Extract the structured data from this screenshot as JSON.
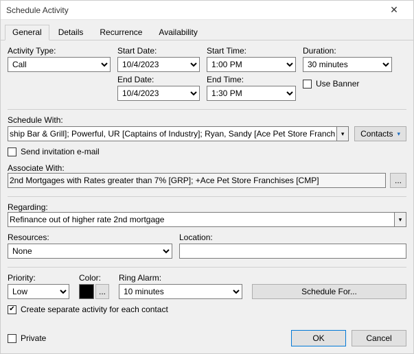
{
  "window": {
    "title": "Schedule Activity"
  },
  "tabs": {
    "general": "General",
    "details": "Details",
    "recurrence": "Recurrence",
    "availability": "Availability"
  },
  "labels": {
    "activity_type": "Activity Type:",
    "start_date": "Start Date:",
    "start_time": "Start Time:",
    "duration": "Duration:",
    "end_date": "End Date:",
    "end_time": "End Time:",
    "use_banner": "Use Banner",
    "schedule_with": "Schedule With:",
    "contacts_btn": "Contacts",
    "send_invite": "Send invitation e-mail",
    "associate_with": "Associate With:",
    "regarding": "Regarding:",
    "resources": "Resources:",
    "location": "Location:",
    "priority": "Priority:",
    "color": "Color:",
    "ring_alarm": "Ring Alarm:",
    "schedule_for": "Schedule For...",
    "create_separate": "Create separate activity for each contact",
    "private": "Private",
    "ok": "OK",
    "cancel": "Cancel",
    "ellipsis": "..."
  },
  "values": {
    "activity_type": "Call",
    "start_date": "10/4/2023",
    "end_date": "10/4/2023",
    "start_time": "1:00 PM",
    "end_time": "1:30 PM",
    "duration": "30 minutes",
    "schedule_with": "ship Bar & Grill]; Powerful, UR [Captains of Industry]; Ryan, Sandy [Ace Pet Store Franchises]",
    "associate_with": "2nd Mortgages with Rates greater than 7% [GRP]; +Ace Pet Store Franchises [CMP]",
    "regarding": "Refinance out of higher rate 2nd mortgage",
    "resources": "None",
    "location": "",
    "priority": "Low",
    "ring_alarm": "10 minutes",
    "color": "#000000"
  },
  "checks": {
    "use_banner": false,
    "send_invite": false,
    "create_separate": true,
    "private": false
  }
}
